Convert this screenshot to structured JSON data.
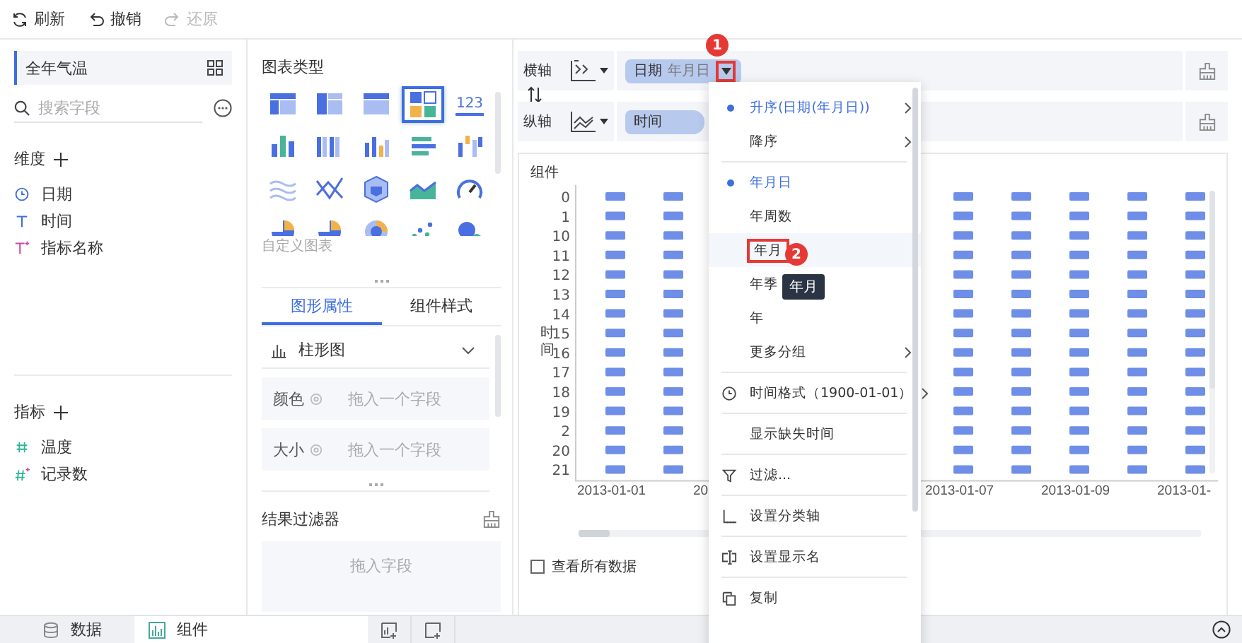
{
  "toolbar": [
    {
      "label": "刷新",
      "kind": "refresh",
      "disabled": false
    },
    {
      "label": "撤销",
      "kind": "undo",
      "disabled": false
    },
    {
      "label": "还原",
      "kind": "redo",
      "disabled": true
    }
  ],
  "dataset": {
    "name": "全年气温"
  },
  "search": {
    "placeholder": "搜索字段"
  },
  "dimensions": {
    "title": "维度",
    "fields": [
      {
        "label": "日期",
        "kind": "date"
      },
      {
        "label": "时间",
        "kind": "text"
      },
      {
        "label": "指标名称",
        "kind": "text-calc"
      }
    ]
  },
  "measures": {
    "title": "指标",
    "fields": [
      {
        "label": "温度",
        "kind": "number"
      },
      {
        "label": "记录数",
        "kind": "number-calc"
      }
    ]
  },
  "chart_types": {
    "title": "图表类型",
    "custom_label": "自定义图表",
    "items": [
      {
        "kind": "table",
        "selected": false
      },
      {
        "kind": "crosstable",
        "selected": false
      },
      {
        "kind": "detail",
        "selected": false
      },
      {
        "kind": "combo",
        "selected": true
      },
      {
        "kind": "number",
        "label": "123",
        "selected": false
      },
      {
        "kind": "stacked",
        "selected": false
      },
      {
        "kind": "grouped",
        "selected": false
      },
      {
        "kind": "bar",
        "selected": false
      },
      {
        "kind": "hbar",
        "selected": false
      },
      {
        "kind": "range",
        "selected": false
      },
      {
        "kind": "wave",
        "selected": false
      },
      {
        "kind": "cross",
        "selected": false
      },
      {
        "kind": "polygon",
        "selected": false
      },
      {
        "kind": "area",
        "selected": false
      },
      {
        "kind": "gauge",
        "selected": false
      },
      {
        "kind": "pie",
        "selected": false
      },
      {
        "kind": "pie",
        "selected": false
      },
      {
        "kind": "rose",
        "selected": false
      },
      {
        "kind": "scatter",
        "selected": false
      },
      {
        "kind": "bubble",
        "selected": false
      }
    ]
  },
  "property_tabs": [
    {
      "label": "图形属性",
      "selected": true
    },
    {
      "label": "组件样式",
      "selected": false
    }
  ],
  "chart_kind": {
    "label": "柱形图"
  },
  "marks": [
    {
      "label": "颜色",
      "placeholder": "拖入一个字段"
    },
    {
      "label": "大小",
      "placeholder": "拖入一个字段"
    }
  ],
  "result_filter": {
    "title": "结果过滤器",
    "placeholder": "拖入字段"
  },
  "axes": [
    {
      "label": "横轴",
      "kind": "x",
      "fields": [
        {
          "name": "日期",
          "grouping": "年月日",
          "menu_open": true
        }
      ]
    },
    {
      "label": "纵轴",
      "kind": "y",
      "fields": [
        {
          "name": "时间",
          "menu_open": false
        }
      ]
    }
  ],
  "widget": {
    "title": "组件",
    "y_title": "时间",
    "y_labels": [
      "0",
      "1",
      "10",
      "11",
      "12",
      "13",
      "14",
      "15",
      "16",
      "17",
      "18",
      "19",
      "2",
      "20",
      "21"
    ],
    "x_labels": [
      "2013-01-01",
      "20",
      "2013-01-07",
      "2013-01-09",
      "2013-01-"
    ],
    "show_all": {
      "label": "查看所有数据",
      "checked": false
    }
  },
  "field_menu": {
    "groups": [
      [
        {
          "label": "升序(日期(年月日))",
          "kind": "option",
          "selected": true,
          "submenu": true,
          "hovered": false
        },
        {
          "label": "降序",
          "kind": "option",
          "selected": false,
          "submenu": true,
          "hovered": false
        }
      ],
      [
        {
          "label": "年月日",
          "kind": "option",
          "selected": true,
          "submenu": false,
          "hovered": false
        },
        {
          "label": "年周数",
          "kind": "option",
          "selected": false,
          "submenu": false,
          "hovered": false
        },
        {
          "label": "年月",
          "kind": "option",
          "selected": false,
          "submenu": false,
          "hovered": true
        },
        {
          "label": "年季",
          "kind": "option",
          "selected": false,
          "submenu": false,
          "hovered": false
        },
        {
          "label": "年",
          "kind": "option",
          "selected": false,
          "submenu": false,
          "hovered": false
        },
        {
          "label": "更多分组",
          "kind": "option",
          "selected": false,
          "submenu": true,
          "hovered": false
        }
      ],
      [
        {
          "label": "时间格式（1900-01-01）",
          "kind": "clock",
          "submenu": true,
          "hovered": false
        }
      ],
      [
        {
          "label": "显示缺失时间",
          "kind": "plain",
          "submenu": false,
          "hovered": false
        }
      ],
      [
        {
          "label": "过滤...",
          "kind": "filter",
          "submenu": false,
          "hovered": false
        }
      ],
      [
        {
          "label": "设置分类轴",
          "kind": "axis",
          "submenu": false,
          "hovered": false
        }
      ],
      [
        {
          "label": "设置显示名",
          "kind": "rename",
          "submenu": false,
          "hovered": false
        }
      ],
      [
        {
          "label": "复制",
          "kind": "copy",
          "submenu": false,
          "hovered": false
        }
      ]
    ]
  },
  "tooltip": {
    "text": "年月"
  },
  "callouts": [
    {
      "label": "1"
    },
    {
      "label": "2"
    }
  ],
  "bottom_tabs": [
    {
      "label": "数据",
      "kind": "data",
      "selected": false
    },
    {
      "label": "组件",
      "kind": "widget",
      "selected": true
    }
  ]
}
